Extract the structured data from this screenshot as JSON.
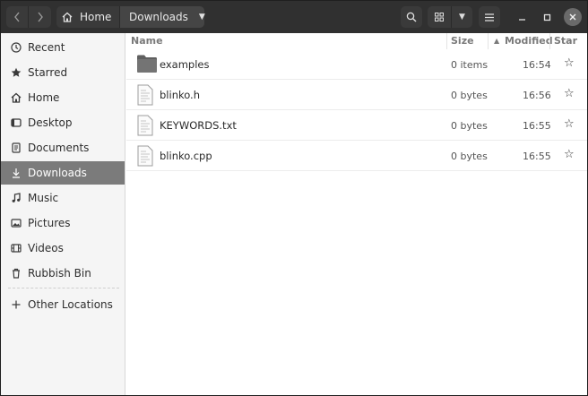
{
  "header": {
    "breadcrumb_home": "Home",
    "breadcrumb_current": "Downloads"
  },
  "sidebar": {
    "items": [
      {
        "label": "Recent",
        "icon": "clock-icon"
      },
      {
        "label": "Starred",
        "icon": "star-icon"
      },
      {
        "label": "Home",
        "icon": "home-icon"
      },
      {
        "label": "Desktop",
        "icon": "desktop-icon"
      },
      {
        "label": "Documents",
        "icon": "document-icon"
      },
      {
        "label": "Downloads",
        "icon": "download-icon"
      },
      {
        "label": "Music",
        "icon": "music-icon"
      },
      {
        "label": "Pictures",
        "icon": "pictures-icon"
      },
      {
        "label": "Videos",
        "icon": "video-icon"
      },
      {
        "label": "Rubbish Bin",
        "icon": "trash-icon"
      }
    ],
    "other_locations": "Other Locations",
    "active": "Downloads"
  },
  "columns": {
    "name": "Name",
    "size": "Size",
    "modified": "Modified",
    "star": "Star"
  },
  "files": [
    {
      "name": "examples",
      "size": "0 items",
      "modified": "16:54",
      "icon": "folder-icon"
    },
    {
      "name": "blinko.h",
      "size": "0 bytes",
      "modified": "16:56",
      "icon": "text-file-icon"
    },
    {
      "name": "KEYWORDS.txt",
      "size": "0 bytes",
      "modified": "16:55",
      "icon": "text-file-icon"
    },
    {
      "name": "blinko.cpp",
      "size": "0 bytes",
      "modified": "16:55",
      "icon": "text-file-icon"
    }
  ],
  "colors": {
    "headerbar": "#303030",
    "sidebar_active": "#7b7b7b"
  }
}
